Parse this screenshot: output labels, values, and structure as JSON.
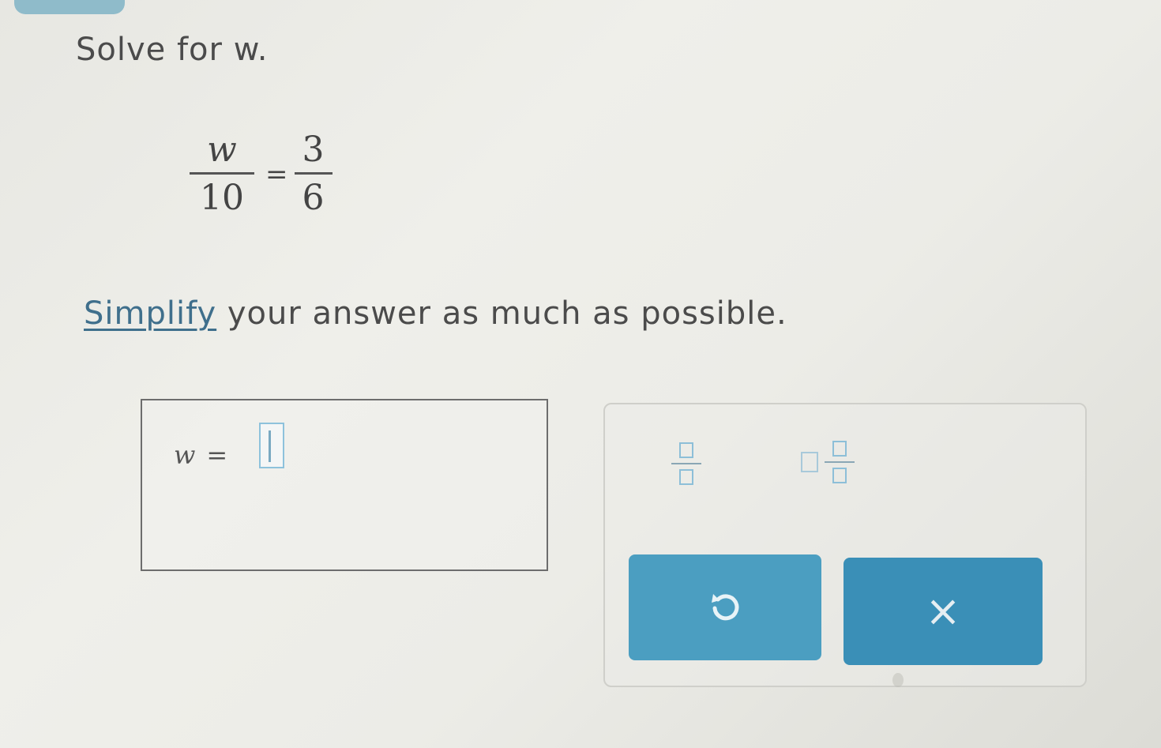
{
  "prompt": {
    "text": "Solve for w."
  },
  "equation": {
    "left_numerator": "w",
    "left_denominator": "10",
    "equals": "=",
    "right_numerator": "3",
    "right_denominator": "6"
  },
  "instruction": {
    "link_text": "Simplify",
    "rest_text": " your answer as much as possible."
  },
  "answer": {
    "variable": "w",
    "equals": "=",
    "value": ""
  },
  "keypad": {
    "clear_label": "×"
  },
  "colors": {
    "accent": "#4b9ec1",
    "link": "#3f6f8c",
    "input_border": "#8ec2dc"
  },
  "icons": {
    "undo": "undo-icon",
    "clear": "x-icon",
    "fraction": "fraction-template-icon",
    "mixed_number": "mixed-number-template-icon"
  }
}
